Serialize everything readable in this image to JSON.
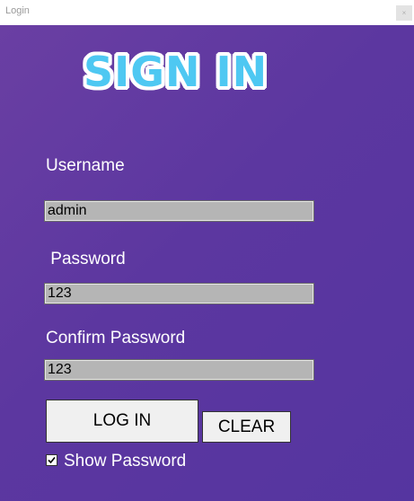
{
  "window": {
    "title": "Login",
    "close_glyph": "×"
  },
  "form": {
    "heading": "SIGN IN",
    "username_label": "Username",
    "username_value": "admin",
    "password_label": " Password",
    "password_value": "123",
    "confirm_label": "Confirm Password",
    "confirm_value": "123",
    "login_button": "LOG IN",
    "clear_button": "CLEAR",
    "show_password_label": "Show Password",
    "show_password_checked": true
  },
  "colors": {
    "background": "#5c37a0",
    "heading_fill": "#4ec8f2",
    "heading_outline": "#ffffff",
    "field_background": "#b5b5b5"
  },
  "icons": {
    "close": "close-icon",
    "checkbox": "checkmark-icon"
  }
}
